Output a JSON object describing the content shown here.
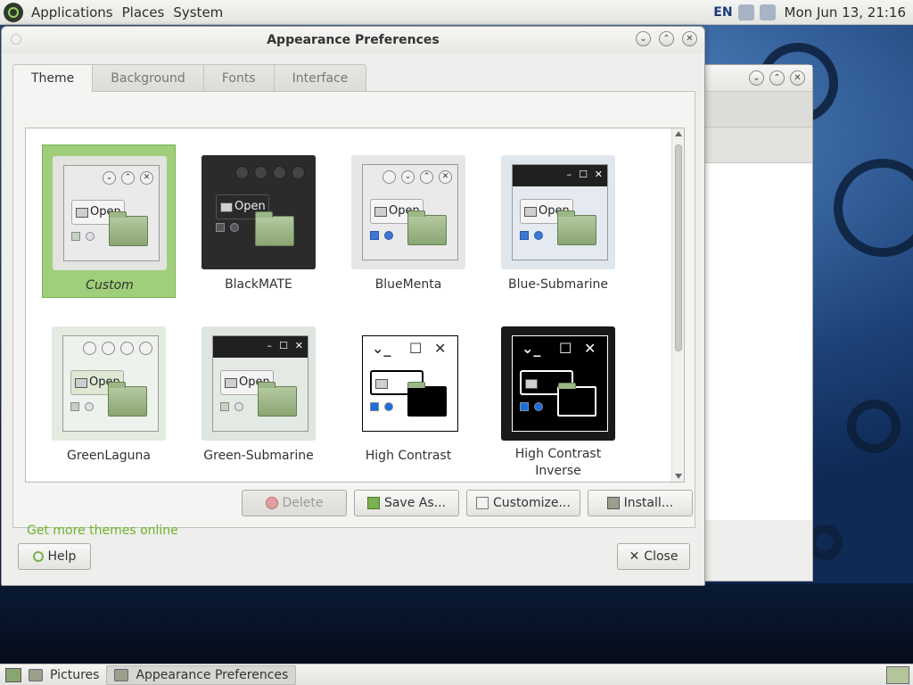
{
  "top_panel": {
    "menus": [
      "Applications",
      "Places",
      "System"
    ],
    "keyboard_layout": "EN",
    "clock": "Mon Jun 13, 21:16"
  },
  "dialog": {
    "title": "Appearance Preferences",
    "tabs": [
      {
        "label": "Theme",
        "active": true
      },
      {
        "label": "Background",
        "active": false
      },
      {
        "label": "Fonts",
        "active": false
      },
      {
        "label": "Interface",
        "active": false
      }
    ],
    "themes": [
      {
        "name": "Custom",
        "selected": true,
        "style": "custom"
      },
      {
        "name": "BlackMATE",
        "selected": false,
        "style": "dark"
      },
      {
        "name": "BlueMenta",
        "selected": false,
        "style": "light"
      },
      {
        "name": "Blue-Submarine",
        "selected": false,
        "style": "submarine"
      },
      {
        "name": "GreenLaguna",
        "selected": false,
        "style": "light"
      },
      {
        "name": "Green-Submarine",
        "selected": false,
        "style": "submarine"
      },
      {
        "name": "High Contrast",
        "selected": false,
        "style": "hc"
      },
      {
        "name": "High Contrast Inverse",
        "selected": false,
        "style": "hci"
      }
    ],
    "preview_open_label": "Open",
    "buttons": {
      "delete": "Delete",
      "save_as": "Save As...",
      "customize": "Customize...",
      "install": "Install..."
    },
    "more_link": "Get more themes online",
    "help": "Help",
    "close": "Close"
  },
  "taskbar": {
    "items": [
      {
        "label": "Pictures",
        "active": false
      },
      {
        "label": "Appearance Preferences",
        "active": true
      }
    ]
  },
  "colors": {
    "selection": "#9fcf7a",
    "link": "#6bb52a"
  }
}
